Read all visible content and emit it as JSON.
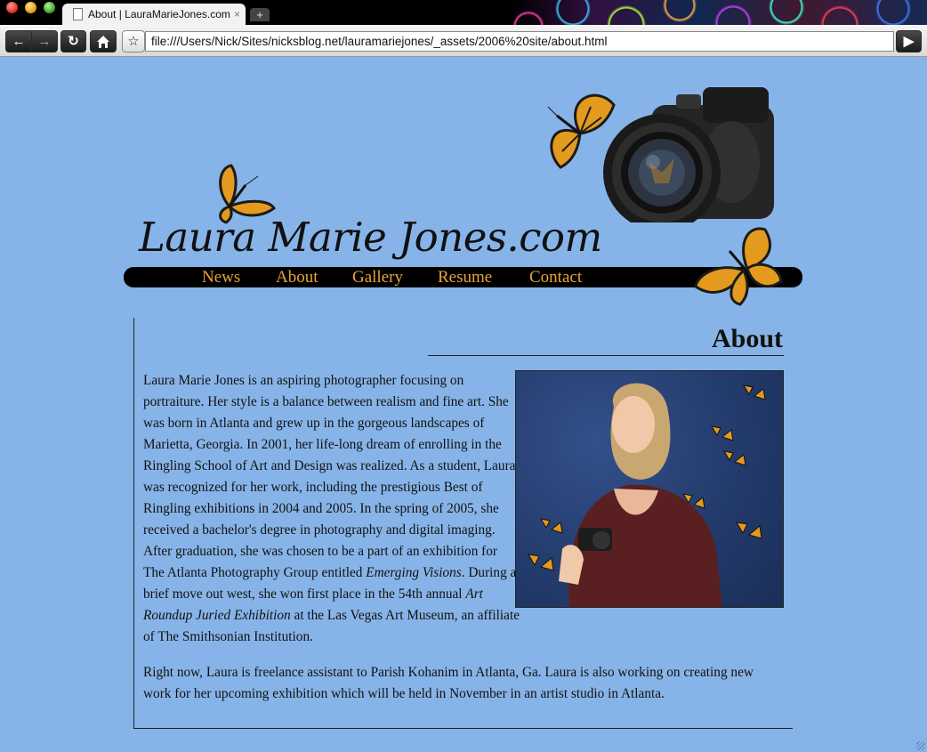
{
  "browser": {
    "tab_title": "About | LauraMarieJones.com",
    "tab_close": "×",
    "new_tab": "+",
    "url": "file:///Users/Nick/Sites/nicksblog.net/lauramariejones/_assets/2006%20site/about.html",
    "icons": [
      "back-icon",
      "forward-icon",
      "reload-icon",
      "home-icon",
      "bookmark-star-icon",
      "go-icon"
    ]
  },
  "site": {
    "title": "Laura Marie Jones.com",
    "nav": [
      {
        "label": "News"
      },
      {
        "label": "About"
      },
      {
        "label": "Gallery"
      },
      {
        "label": "Resume"
      },
      {
        "label": "Contact"
      }
    ],
    "colors": {
      "background": "#87b4e8",
      "nav_bar": "#000000",
      "nav_text": "#e8a33a"
    }
  },
  "about": {
    "heading": "About",
    "p1_a": "Laura Marie Jones is an aspiring photographer focusing on portraiture. Her style is a balance between realism and fine art. She was born in Atlanta and grew up in the gorgeous landscapes of Marietta, Georgia. In 2001, her life-long dream of enrolling in the Ringling School of Art and Design was realized. As a student, Laura was recognized for her work, including the prestigious Best of Ringling exhibitions in 2004 and 2005. In the spring of 2005, she received a bachelor's degree in photography and digital imaging. After graduation, she was chosen to be a part of an exhibition for The Atlanta Photography Group entitled ",
    "p1_em1": "Emerging Visions",
    "p1_b": ". During a brief move out west, she won first place in the 54th annual ",
    "p1_em2": "Art Roundup Juried Exhibition",
    "p1_c": " at the Las Vegas Art Museum, an affiliate of The Smithsonian Institution.",
    "p2": "Right now, Laura is freelance assistant to Parish Kohanim in Atlanta, Ga. Laura is also working on creating new work for her upcoming exhibition which will be held in November in an artist studio in Atlanta."
  }
}
